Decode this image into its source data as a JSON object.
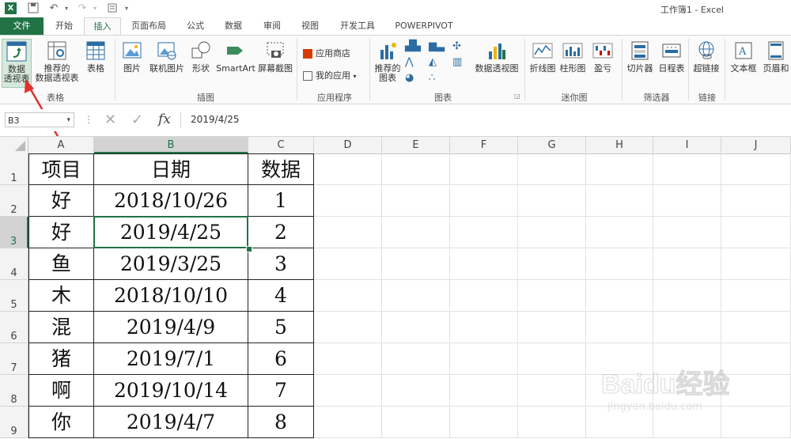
{
  "window": {
    "title": "工作簿1 - Excel"
  },
  "tabs": [
    "文件",
    "开始",
    "插入",
    "页面布局",
    "公式",
    "数据",
    "审阅",
    "视图",
    "开发工具",
    "POWERPIVOT"
  ],
  "ribbon": {
    "pivot_table": "数据\n透视表",
    "recommended_pivot": "推荐的\n数据透视表",
    "table": "表格",
    "group_tables": "表格",
    "picture": "图片",
    "online_picture": "联机图片",
    "shapes": "形状",
    "smartart": "SmartArt",
    "screenshot": "屏幕截图",
    "group_illustrations": "插图",
    "app_store": "应用商店",
    "my_apps": "我的应用",
    "group_apps": "应用程序",
    "recommended_charts": "推荐的\n图表",
    "pivot_chart": "数据透视图",
    "group_charts": "图表",
    "spark_line": "折线图",
    "spark_column": "柱形图",
    "spark_winloss": "盈亏",
    "group_sparklines": "迷你图",
    "slicer": "切片器",
    "timeline": "日程表",
    "group_filters": "筛选器",
    "hyperlink": "超链接",
    "group_links": "链接",
    "textbox": "文本框",
    "header_footer": "页眉和"
  },
  "formula_bar": {
    "name_box": "B3",
    "fx": "fx",
    "value": "2019/4/25"
  },
  "columns": [
    "A",
    "B",
    "C",
    "D",
    "E",
    "F",
    "G",
    "H",
    "I",
    "J"
  ],
  "rows": [
    "1",
    "2",
    "3",
    "4",
    "5",
    "6",
    "7",
    "8",
    "9"
  ],
  "table": {
    "headers": [
      "项目",
      "日期",
      "数据"
    ],
    "rows": [
      [
        "好",
        "2018/10/26",
        "1"
      ],
      [
        "好",
        "2019/4/25",
        "2"
      ],
      [
        "鱼",
        "2019/3/25",
        "3"
      ],
      [
        "木",
        "2018/10/10",
        "4"
      ],
      [
        "混",
        "2019/4/9",
        "5"
      ],
      [
        "猪",
        "2019/7/1",
        "6"
      ],
      [
        "啊",
        "2019/10/14",
        "7"
      ],
      [
        "你",
        "2019/4/7",
        "8"
      ]
    ]
  },
  "watermark": {
    "text": "Baidu经验",
    "url": "jingyan.baidu.com"
  },
  "colors": {
    "accent": "#217346",
    "arrow": "#e0312b",
    "selection": "#217346"
  }
}
